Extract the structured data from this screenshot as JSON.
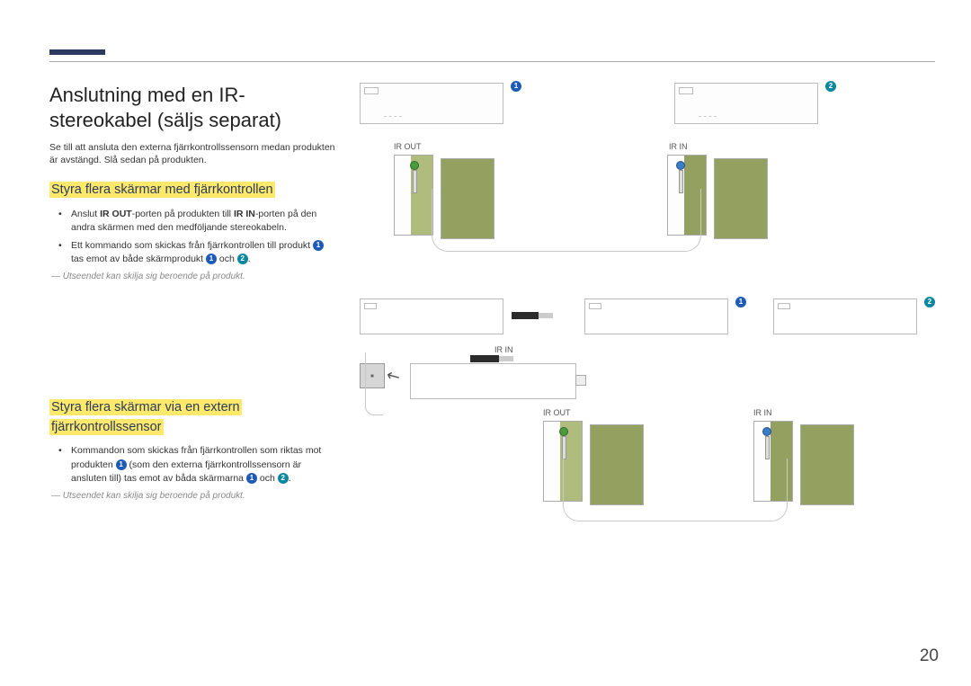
{
  "title": "Anslutning med en IR-stereokabel (säljs separat)",
  "intro": "Se till att ansluta den externa fjärrkontrollssensorn medan produkten är avstängd. Slå sedan på produkten.",
  "section1": {
    "heading": "Styra flera skärmar med fjärrkontrollen",
    "b1_pre": "Anslut ",
    "b1_irout": "IR OUT",
    "b1_mid": "-porten på produkten till ",
    "b1_irin": "IR IN",
    "b1_post": "-porten på den andra skärmen med den medföljande stereokabeln.",
    "b2_pre": "Ett kommando som skickas från fjärrkontrollen till produkt ",
    "b2_mid": " tas emot av både skärmprodukt ",
    "b2_and": " och ",
    "b2_end": ".",
    "note": "Utseendet kan skilja sig beroende på produkt."
  },
  "section2": {
    "heading": "Styra flera skärmar via en extern fjärrkontrollssensor",
    "b1_pre": "Kommandon som skickas från fjärrkontrollen som riktas mot produkten ",
    "b1_mid": " (som den externa fjärrkontrollssensorn är ansluten till) tas emot av båda skärmarna ",
    "b1_and": " och ",
    "b1_end": ".",
    "note": "Utseendet kan skilja sig beroende på produkt."
  },
  "labels": {
    "irout": "IR OUT",
    "irin": "IR IN",
    "one": "1",
    "two": "2"
  },
  "pageNumber": "20"
}
